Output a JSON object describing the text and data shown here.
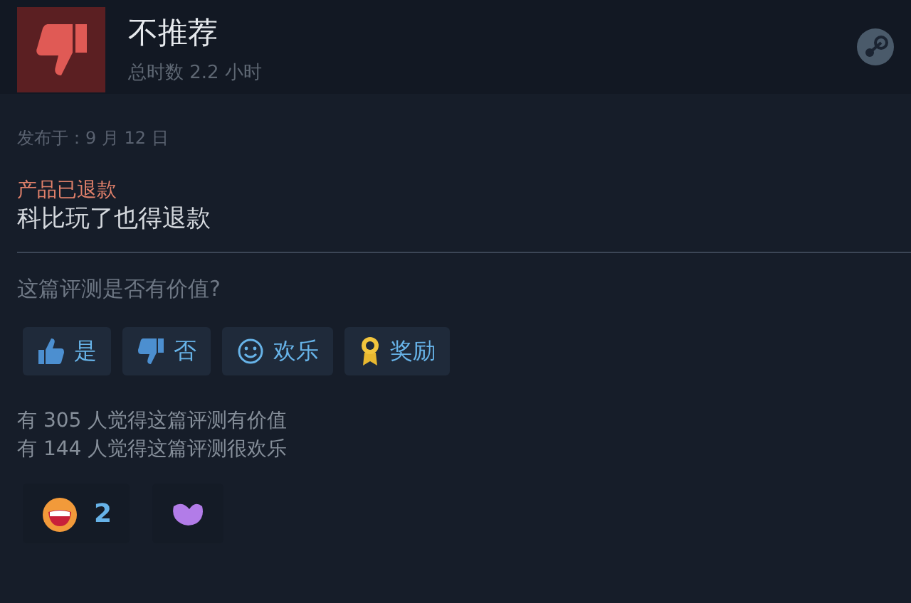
{
  "review": {
    "verdict": "不推荐",
    "recommended": false,
    "playtime": "总时数 2.2 小时",
    "posted": "发布于：9 月 12 日",
    "refund_note": "产品已退款",
    "text": "科比玩了也得退款"
  },
  "helpful": {
    "question": "这篇评测是否有价值?",
    "buttons": [
      {
        "kind": "yes",
        "label": "是"
      },
      {
        "kind": "no",
        "label": "否"
      },
      {
        "kind": "funny",
        "label": "欢乐"
      },
      {
        "kind": "award",
        "label": "奖励"
      }
    ]
  },
  "stats": [
    "有 305 人觉得这篇评测有价值",
    "有 144 人觉得这篇评测很欢乐"
  ],
  "awards": [
    {
      "kind": "laugh",
      "count": "2"
    },
    {
      "kind": "blob"
    }
  ]
}
